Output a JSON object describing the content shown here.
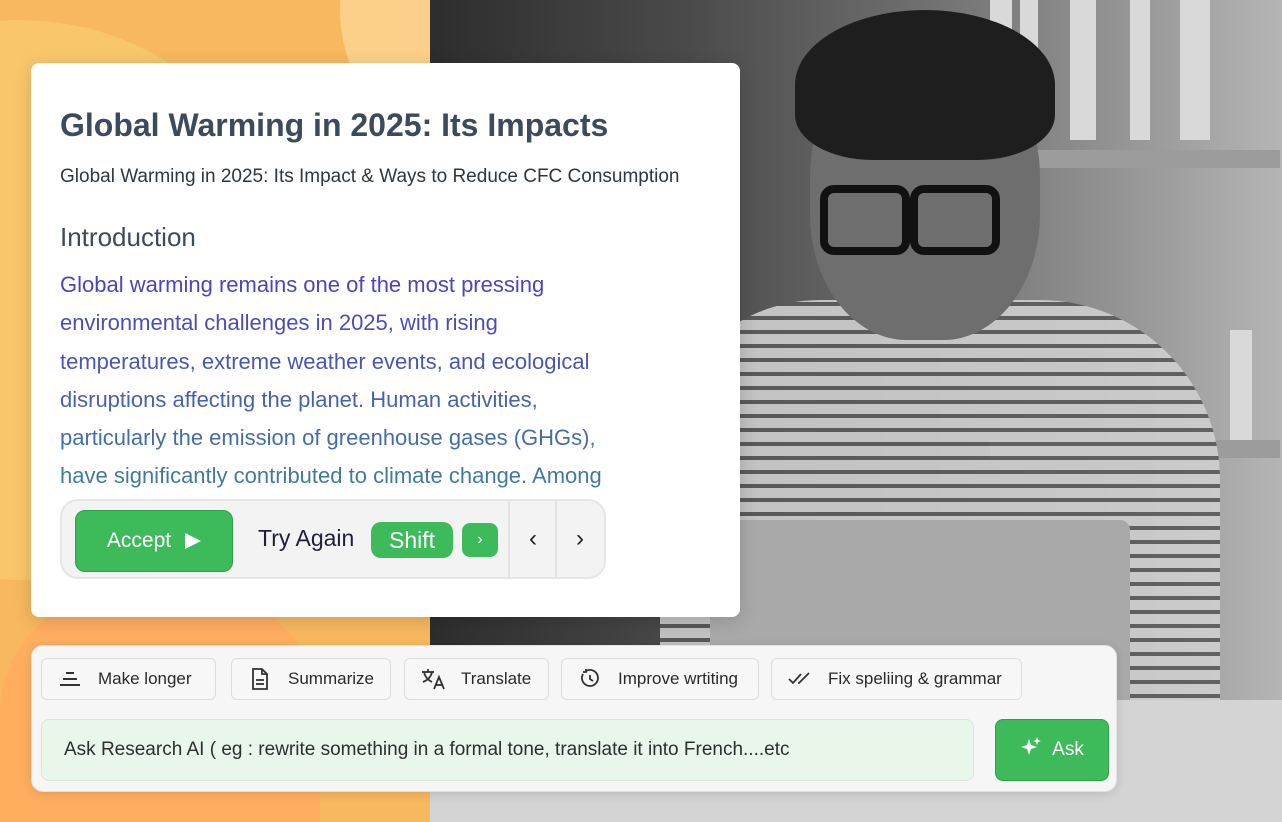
{
  "document": {
    "title": "Global Warming in 2025: Its Impacts",
    "subtitle": "Global Warming in 2025: Its Impact & Ways to Reduce CFC Consumption",
    "section_heading": "Introduction",
    "body_lines": [
      "Global warming remains one of the most pressing",
      "environmental challenges in 2025, with rising",
      "temperatures, extreme weather events, and ecological",
      "disruptions affecting the planet. Human activities,",
      "particularly the emission of greenhouse gases (GHGs),",
      "have significantly contributed to climate change. Among"
    ]
  },
  "suggestion_bar": {
    "accept_label": "Accept",
    "try_again_label": "Try Again",
    "shift_key_label": "Shift",
    "shift_arrow": "›",
    "prev_glyph": "‹",
    "next_glyph": "›"
  },
  "ai_panel": {
    "actions": [
      {
        "label": "Make longer",
        "icon": "align-center-icon"
      },
      {
        "label": "Summarize",
        "icon": "document-icon"
      },
      {
        "label": "Translate",
        "icon": "translate-icon"
      },
      {
        "label": "Improve wrtiting",
        "icon": "refresh-timer-icon"
      },
      {
        "label": "Fix speliing & grammar",
        "icon": "double-check-icon"
      }
    ],
    "ask_placeholder": "Ask Research AI ( eg : rewrite something in a formal tone, translate it into French....etc",
    "ask_button_label": "Ask"
  },
  "colors": {
    "accent_green": "#3dbb5a",
    "background_orange": "#f7b85f",
    "input_green_tint": "#e9f7ea",
    "title_slate": "#3c4a5c"
  }
}
